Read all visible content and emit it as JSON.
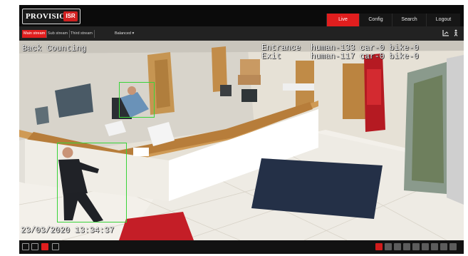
{
  "brand": {
    "logo_text": "PROVISION",
    "logo_badge": "ISR"
  },
  "nav": [
    {
      "label": "Live",
      "active": true
    },
    {
      "label": "Config",
      "active": false
    },
    {
      "label": "Search",
      "active": false
    },
    {
      "label": "Logout",
      "active": false
    }
  ],
  "streams": [
    {
      "label": "Main stream",
      "active": true
    },
    {
      "label": "Sub stream",
      "active": false
    },
    {
      "label": "Third stream",
      "active": false
    }
  ],
  "quality": {
    "label": "Balanced",
    "caret": "▾"
  },
  "subbar_icons": [
    "layout-icon",
    "person-icon"
  ],
  "overlay": {
    "title": "Back Counting",
    "entrance": "Entrance  human-133 car-0 bike-0",
    "exit": "Exit      human-117 car-0 bike-0",
    "timestamp": "23/03/2020 13:34:37"
  },
  "colors": {
    "accent": "#e01e1e",
    "detection_box": "#39d439"
  },
  "bottom_left_icons": [
    "fullscreen-icon",
    "grid-icon",
    "record-icon",
    "layout-icon"
  ],
  "bottom_right_icons": [
    "alarm-icon",
    "snapshot-icon",
    "record-icon",
    "zoom-icon",
    "audio-icon",
    "talk-icon",
    "ptz-icon",
    "fisheye-icon",
    "display-ratio-icon"
  ]
}
